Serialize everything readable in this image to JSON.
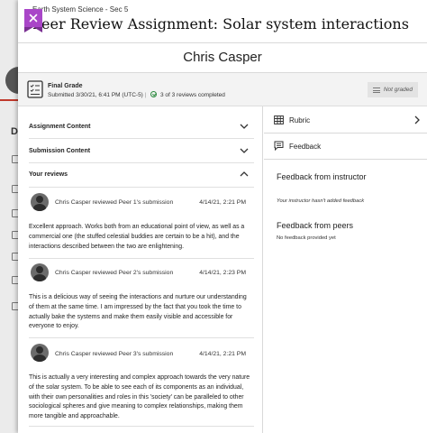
{
  "background": {
    "nav_letter": "D"
  },
  "header": {
    "course": "Earth System Science - Sec 5",
    "title": "Peer Review Assignment: Solar system interactions"
  },
  "student_name": "Chris Casper",
  "grade": {
    "label": "Final Grade",
    "submitted": "Submitted 3/30/21, 6:41 PM (UTC-5)",
    "reviews_completed": "3 of 3 reviews completed",
    "status": "Not graded"
  },
  "sections": {
    "assignment_content": "Assignment Content",
    "submission_content": "Submission Content",
    "your_reviews": "Your reviews"
  },
  "reviews": [
    {
      "title": "Chris Casper reviewed Peer 1's submission",
      "date": "4/14/21, 2:21 PM",
      "text": "Excellent approach. Works both from an educational point of view, as well as a commercial one (the stuffed celestial buddies are certain to be a hit), and the interactions described between the two are enlightening."
    },
    {
      "title": "Chris Casper reviewed Peer 2's submission",
      "date": "4/14/21, 2:23 PM",
      "text": "This is a delicious way of seeing the interactions and nurture our understanding of them at the same time. I am impressed by the fact that you took the time to actually bake the systems and make them easily visible and accessible for everyone to enjoy."
    },
    {
      "title": "Chris Casper reviewed Peer 3's submission",
      "date": "4/14/21, 2:21 PM",
      "text": "This is actually a very interesting and complex approach towards the very nature of the solar system. To be able to see each of its components as an individual, with their own personalities and roles in this 'society' can be paralleled to other sociological spheres and give meaning to complex relationships, making them more tangible and approachable."
    }
  ],
  "right_panel": {
    "rubric": "Rubric",
    "feedback": "Feedback",
    "instructor_heading": "Feedback from instructor",
    "instructor_note": "Your instructor hasn't added feedback",
    "peers_heading": "Feedback from peers",
    "peers_note": "No feedback provided yet"
  },
  "colors": {
    "close_accent": "#a946c8",
    "success": "#2b8a3e"
  }
}
